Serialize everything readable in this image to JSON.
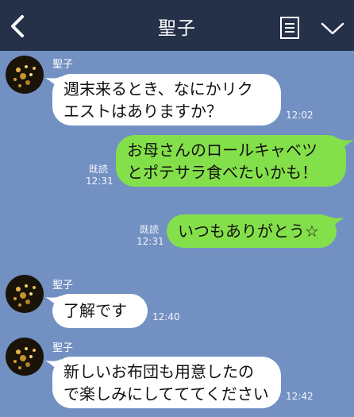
{
  "header": {
    "title": "聖子"
  },
  "messages": [
    {
      "side": "in",
      "sender": "聖子",
      "lines": [
        "週末来るとき、なにかリク",
        "エストはありますか？"
      ],
      "time": "12:02"
    },
    {
      "side": "out",
      "read": "既読",
      "lines": [
        "お母さんのロールキャベツ",
        "とポテサラ食べたいかも！"
      ],
      "time": "12:31"
    },
    {
      "side": "out",
      "read": "既読",
      "lines": [
        "いつもありがとう☆"
      ],
      "time": "12:31"
    },
    {
      "side": "in",
      "sender": "聖子",
      "lines": [
        "了解です"
      ],
      "time": "12:40"
    },
    {
      "side": "in",
      "sender": "聖子",
      "lines": [
        "新しいお布団も用意したの",
        "で楽しみにしてててください"
      ],
      "time": "12:42"
    }
  ],
  "colors": {
    "background": "#7290c2",
    "header": "#253049",
    "incoming_bubble": "#ffffff",
    "outgoing_bubble": "#84e04a"
  },
  "icons": {
    "back": "back-chevron-icon",
    "notes": "notes-icon",
    "menu": "chevron-down-icon"
  }
}
